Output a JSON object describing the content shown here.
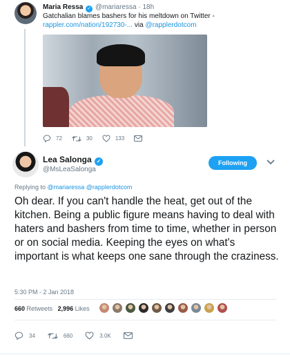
{
  "parent_tweet": {
    "author_name": "Maria Ressa",
    "verified": true,
    "handle": "@mariaressa",
    "separator": "·",
    "time": "18h",
    "text_line1": "Gatchalian blames bashers for his meltdown on Twitter -",
    "link": "rappler.com/nation/192730-...",
    "via_label": "via",
    "via_handle": "@rapplerdotcom",
    "actions": {
      "replies": "72",
      "retweets": "30",
      "likes": "133"
    }
  },
  "tweet": {
    "author_name": "Lea Salonga",
    "verified": true,
    "handle": "@MsLeaSalonga",
    "follow_label": "Following",
    "replying_prefix": "Replying to",
    "replying_to": [
      "@mariaressa",
      "@rapplerdotcom"
    ],
    "body": "Oh dear. If you can't handle the heat, get out of the kitchen. Being a public figure means having to deal with haters and bashers from time to time, whether in person or on social media. Keeping the eyes on what's important is what keeps one sane through the craziness.",
    "timestamp": "5:30 PM - 2 Jan 2018",
    "stats": {
      "retweets_count": "660",
      "retweets_label": "Retweets",
      "likes_count": "2,996",
      "likes_label": "Likes"
    },
    "liker_colors": [
      "#c48a72",
      "#8b7a6b",
      "#4a5a40",
      "#2b2b2b",
      "#6f5b48",
      "#3f3f3f",
      "#9a5c48",
      "#7a8a97",
      "#c9a24c",
      "#b05050"
    ],
    "actions": {
      "replies": "34",
      "retweets": "660",
      "likes": "3.0K"
    }
  },
  "colors": {
    "accent": "#1da1f2",
    "link": "#1b95e0",
    "muted": "#657786",
    "text": "#14171a"
  }
}
